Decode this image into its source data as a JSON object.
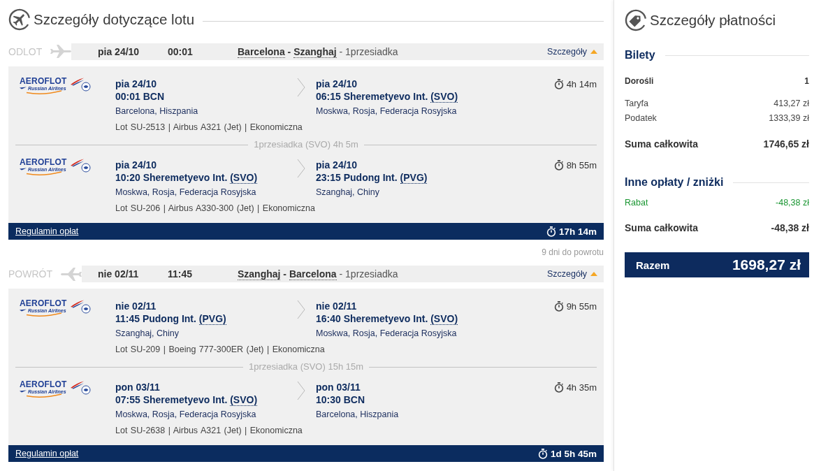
{
  "flight_details": {
    "title": "Szczegóły dotyczące lotu"
  },
  "legs": [
    {
      "kind": "outbound",
      "label": "ODLOT",
      "date": "pia 24/10",
      "time": "00:01",
      "route": {
        "origin": "Barcelona",
        "dash": "-",
        "destination": "Szanghaj",
        "stops": "- 1przesiadka"
      },
      "details_link": {
        "label": "Szczegóły",
        "expanded": true
      },
      "items": [
        {
          "kind": "flight",
          "airline": {
            "name": "AEROFLOT",
            "tagline": "Russian Airlines"
          },
          "departure": {
            "date": "pia 24/10",
            "place": "00:01 BCN",
            "city": "Barcelona, Hiszpania"
          },
          "arrival": {
            "date": "pia 24/10",
            "place": "06:15 Sheremetyevo Int.",
            "code": "(SVO)",
            "city": "Moskwa, Rosja, Federacja Rosyjska"
          },
          "duration": "4h 14m",
          "info": "Lot SU-2513 | Airbus A321 (Jet) | Ekonomiczna"
        },
        {
          "kind": "layover",
          "text": "1przesiadka (SVO) 4h 5m"
        },
        {
          "kind": "flight",
          "airline": {
            "name": "AEROFLOT",
            "tagline": "Russian Airlines"
          },
          "departure": {
            "date": "pia 24/10",
            "place": "10:20 Sheremetyevo Int.",
            "code": "(SVO)",
            "city": "Moskwa, Rosja, Federacja Rosyjska"
          },
          "arrival": {
            "date": "pia 24/10",
            "place": "23:15 Pudong Int.",
            "code": "(PVG)",
            "city": "Szanghaj, Chiny"
          },
          "duration": "8h 55m",
          "info": "Lot SU-206 | Airbus A330-300 (Jet) | Ekonomiczna"
        }
      ],
      "footer": {
        "link": "Regulamin opłat",
        "total_duration": "17h 14m"
      }
    },
    {
      "kind": "return",
      "note": "9 dni do powrotu",
      "label": "POWRÓT",
      "date": "nie 02/11",
      "time": "11:45",
      "route": {
        "origin": "Szanghaj",
        "dash": "-",
        "destination": "Barcelona",
        "stops": "- 1przesiadka"
      },
      "details_link": {
        "label": "Szczegóły",
        "expanded": true
      },
      "items": [
        {
          "kind": "flight",
          "airline": {
            "name": "AEROFLOT",
            "tagline": "Russian Airlines"
          },
          "departure": {
            "date": "nie 02/11",
            "place": "11:45 Pudong Int.",
            "code": "(PVG)",
            "city": "Szanghaj, Chiny"
          },
          "arrival": {
            "date": "nie 02/11",
            "place": "16:40 Sheremetyevo Int.",
            "code": "(SVO)",
            "city": "Moskwa, Rosja, Federacja Rosyjska"
          },
          "duration": "9h 55m",
          "info": "Lot SU-209 | Boeing 777-300ER (Jet) | Ekonomiczna"
        },
        {
          "kind": "layover",
          "text": "1przesiadka (SVO) 15h 15m"
        },
        {
          "kind": "flight",
          "airline": {
            "name": "AEROFLOT",
            "tagline": "Russian Airlines"
          },
          "departure": {
            "date": "pon 03/11",
            "place": "07:55 Sheremetyevo Int.",
            "code": "(SVO)",
            "city": "Moskwa, Rosja, Federacja Rosyjska"
          },
          "arrival": {
            "date": "pon 03/11",
            "place": "10:30 BCN",
            "city": "Barcelona, Hiszpania"
          },
          "duration": "4h 35m",
          "info": "Lot SU-2638 | Airbus A321 (Jet) | Ekonomiczna"
        }
      ],
      "footer": {
        "link": "Regulamin opłat",
        "total_duration": "1d 5h 45m"
      }
    }
  ],
  "payment": {
    "title": "Szczegóły płatności",
    "sections": [
      {
        "title": "Bilety",
        "rows": [
          {
            "kind": "group",
            "label": "Dorośli",
            "value": "1"
          },
          {
            "kind": "item",
            "label": "Taryfa",
            "value": "413,27 zł"
          },
          {
            "kind": "item",
            "label": "Podatek",
            "value": "1333,39 zł"
          },
          {
            "kind": "total",
            "label": "Suma całkowita",
            "value": "1746,65 zł"
          }
        ]
      },
      {
        "title": "Inne opłaty / zniżki",
        "rows": [
          {
            "kind": "discount",
            "label": "Rabat",
            "value": "-48,38 zł"
          },
          {
            "kind": "total",
            "label": "Suma całkowita",
            "value": "-48,38 zł"
          }
        ]
      }
    ],
    "grand_total": {
      "label": "Razem",
      "value": "1698,27 zł"
    }
  }
}
